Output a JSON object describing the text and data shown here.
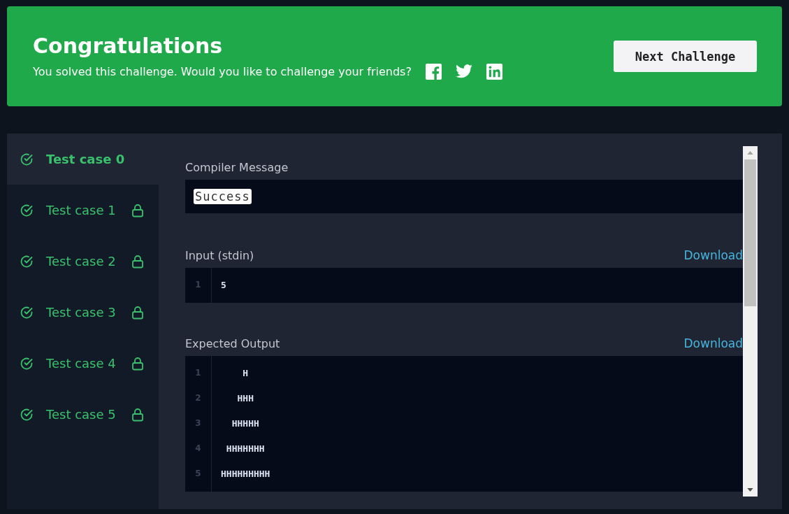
{
  "banner": {
    "title": "Congratulations",
    "message": "You solved this challenge. Would you like to challenge your friends?",
    "next_button": "Next Challenge"
  },
  "test_cases": [
    {
      "label": "Test case 0",
      "selected": true,
      "locked": false
    },
    {
      "label": "Test case 1",
      "selected": false,
      "locked": true
    },
    {
      "label": "Test case 2",
      "selected": false,
      "locked": true
    },
    {
      "label": "Test case 3",
      "selected": false,
      "locked": true
    },
    {
      "label": "Test case 4",
      "selected": false,
      "locked": true
    },
    {
      "label": "Test case 5",
      "selected": false,
      "locked": true
    }
  ],
  "compiler_message": {
    "label": "Compiler Message",
    "value": "Success"
  },
  "input": {
    "label": "Input (stdin)",
    "download": "Download",
    "lines": [
      {
        "number": "1",
        "text": "5"
      }
    ]
  },
  "expected_output": {
    "label": "Expected Output",
    "download": "Download",
    "lines": [
      {
        "number": "1",
        "text": "    H"
      },
      {
        "number": "2",
        "text": "   HHH"
      },
      {
        "number": "3",
        "text": "  HHHHH"
      },
      {
        "number": "4",
        "text": " HHHHHHH"
      },
      {
        "number": "5",
        "text": "HHHHHHHHH"
      }
    ]
  }
}
